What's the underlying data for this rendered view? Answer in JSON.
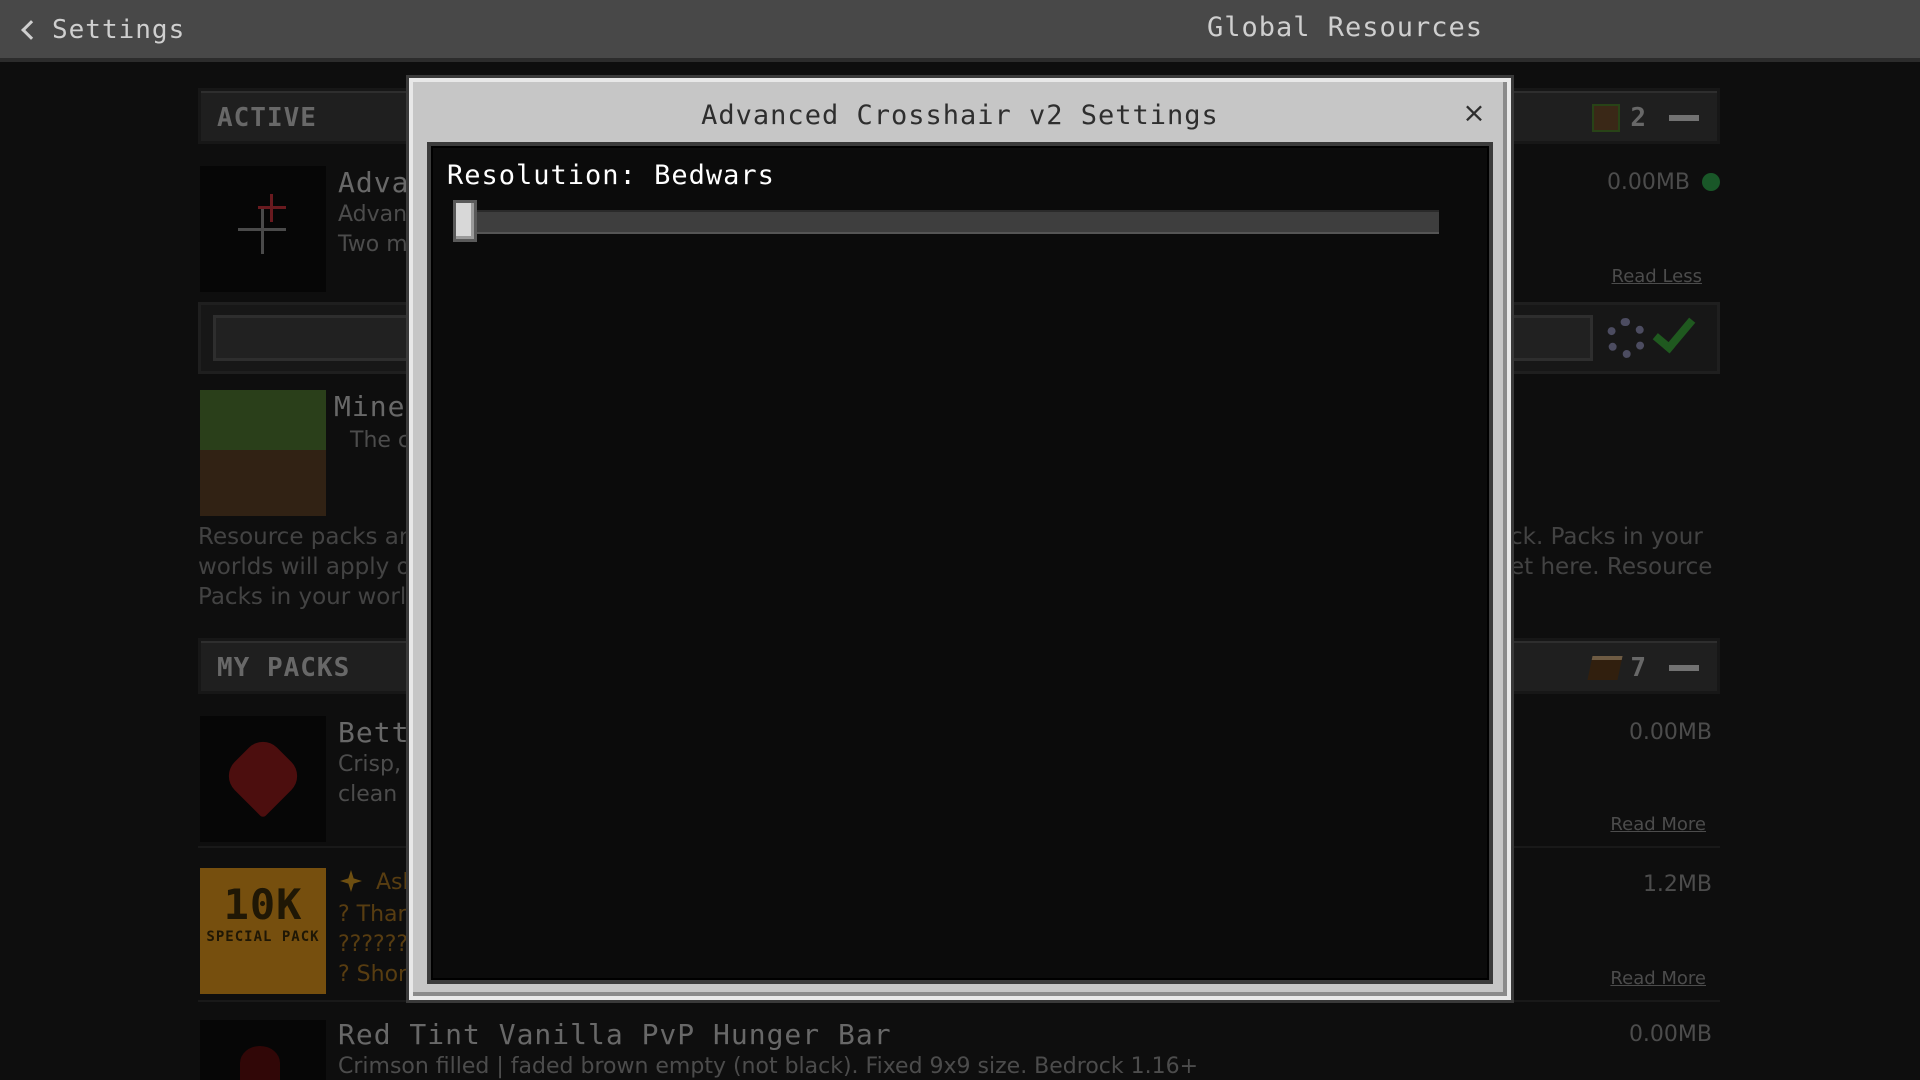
{
  "topbar": {
    "back_label": "Settings",
    "title": "Global Resources"
  },
  "active_section": {
    "label": "ACTIVE",
    "count": "2"
  },
  "active_item": {
    "title": "Adva",
    "desc_lines": [
      "Advan",
      "Two m"
    ],
    "size": "0.00MB",
    "read_link": "Read Less"
  },
  "minecraft_item": {
    "title": "Minec",
    "desc": "The c"
  },
  "info_text": {
    "left": [
      "Resource packs are",
      "worlds will apply o",
      "Packs in your world"
    ],
    "right": [
      "ck. Packs in your",
      "et here. Resource"
    ]
  },
  "mypacks_section": {
    "label": "MY PACKS",
    "count": "7"
  },
  "packs": [
    {
      "title": "Bette",
      "desc_lines": [
        "Crisp,",
        "clean"
      ],
      "size": "0.00MB",
      "read_link": "Read More"
    },
    {
      "title": "Ash",
      "desc_lines": [
        "? Thar",
        "???????",
        "? Shor"
      ],
      "size": "1.2MB",
      "read_link": "Read More",
      "thumb_text": "10K",
      "thumb_sub": "SPECIAL PACK"
    },
    {
      "title": "Red Tint Vanilla PvP Hunger Bar",
      "desc_lines": [
        "Crimson filled | faded brown empty (not black). Fixed 9x9 size. Bedrock 1.16+"
      ],
      "size": "0.00MB"
    }
  ],
  "modal": {
    "title": "Advanced Crosshair v2 Settings",
    "close_label": "×",
    "slider_label": "Resolution: Bedwars",
    "slider_value": 0.0
  },
  "colors": {
    "accent_green": "#3aa23a",
    "status_dot": "#2e9e4a"
  },
  "icons": [
    "back-chevron-icon",
    "close-icon",
    "gear-icon",
    "checkmark-icon",
    "grass-block-icon",
    "book-icon",
    "minus-icon"
  ]
}
